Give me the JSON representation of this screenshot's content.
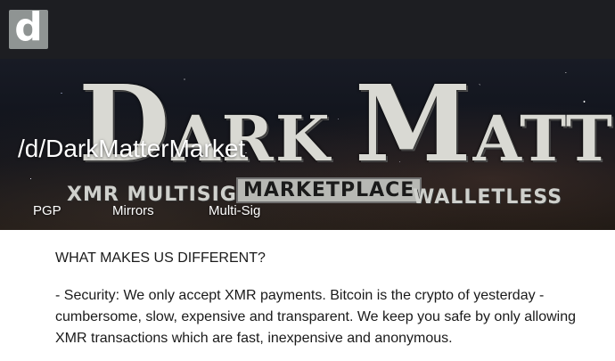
{
  "header": {
    "logo_letter": "d",
    "logo_icon": "d-logo-icon",
    "background_color": "#1d1e22",
    "logo_color": "#8f9493"
  },
  "banner": {
    "title": "/d/DarkMatterMarket",
    "art": {
      "line1": "DARK MATTER",
      "xmr": "XMR MULTISIG",
      "marketplace": "MARKETPLACE",
      "walletless": "WALLETLESS"
    },
    "nav": [
      {
        "label": "PGP"
      },
      {
        "label": "Mirrors"
      },
      {
        "label": "Multi-Sig"
      }
    ]
  },
  "content": {
    "heading": "WHAT MAKES US DIFFERENT?",
    "paragraph": "- Security: We only accept XMR payments. Bitcoin is the crypto of yesterday - cumbersome, slow, expensive and transparent. We keep you safe by only allowing XMR transactions which are fast, inexpensive and anonymous."
  }
}
